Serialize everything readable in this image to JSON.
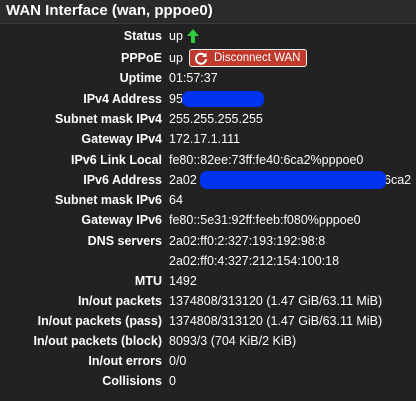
{
  "panel": {
    "title": "WAN Interface (wan, pppoe0)"
  },
  "colors": {
    "background": "#222222",
    "status_up": "#2ecc40",
    "disconnect_button": "#c0392b",
    "redaction": "#0033ee"
  },
  "status": {
    "label": "Status",
    "value": "up",
    "icon": "arrow-up-icon"
  },
  "pppoe": {
    "label": "PPPoE",
    "value": "up",
    "button_label": "Disconnect WAN",
    "button_icon": "refresh-icon"
  },
  "uptime": {
    "label": "Uptime",
    "value": "01:57:37"
  },
  "ipv4_address": {
    "label": "IPv4 Address",
    "value": "95."
  },
  "subnet_mask_ipv4": {
    "label": "Subnet mask IPv4",
    "value": "255.255.255.255"
  },
  "gateway_ipv4": {
    "label": "Gateway IPv4",
    "value": "172.17.1.111"
  },
  "ipv6_link_local": {
    "label": "IPv6 Link Local",
    "value": "fe80::82ee:73ff:fe40:6ca2%pppoe0"
  },
  "ipv6_address": {
    "label": "IPv6 Address",
    "value_start": "2a02",
    "value_end": "6ca2"
  },
  "subnet_mask_ipv6": {
    "label": "Subnet mask IPv6",
    "value": "64"
  },
  "gateway_ipv6": {
    "label": "Gateway IPv6",
    "value": "fe80::5e31:92ff:feeb:f080%pppoe0"
  },
  "dns_servers": {
    "label": "DNS servers",
    "values": [
      "2a02:ff0:2:327:193:192:98:8",
      "2a02:ff0:4:327:212:154:100:18"
    ]
  },
  "mtu": {
    "label": "MTU",
    "value": "1492"
  },
  "in_out_packets": {
    "label": "In/out packets",
    "value": "1374808/313120 (1.47 GiB/63.11 MiB)"
  },
  "in_out_packets_pass": {
    "label": "In/out packets (pass)",
    "value": "1374808/313120 (1.47 GiB/63.11 MiB)"
  },
  "in_out_packets_block": {
    "label": "In/out packets (block)",
    "value": "8093/3 (704 KiB/2 KiB)"
  },
  "in_out_errors": {
    "label": "In/out errors",
    "value": "0/0"
  },
  "collisions": {
    "label": "Collisions",
    "value": "0"
  }
}
